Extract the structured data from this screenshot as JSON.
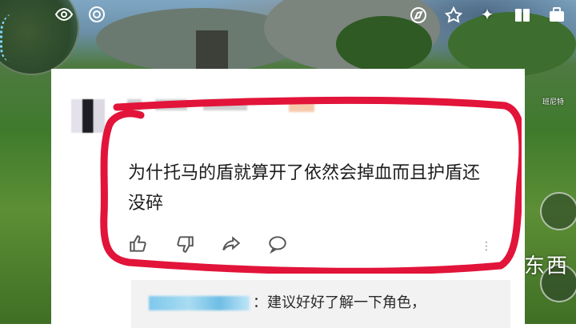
{
  "game_hud": {
    "character_name": "班尼特",
    "overlay_text": "东西",
    "icons": [
      "eye-icon",
      "wish-icon",
      "compass-icon",
      "battlepass-icon",
      "star-icon",
      "book-icon",
      "bag-icon"
    ]
  },
  "comment": {
    "text": "为什托马的盾就算开了依然会掉血而且护盾还没碎",
    "actions": [
      "like-icon",
      "dislike-icon",
      "share-icon",
      "reply-icon"
    ]
  },
  "reply": {
    "text": "：建议好好了解一下角色，"
  },
  "colors": {
    "highlight": "#e2143a",
    "card_bg": "#ffffff",
    "reply_bg": "#f2f2f2",
    "text": "#1d1d1d"
  }
}
